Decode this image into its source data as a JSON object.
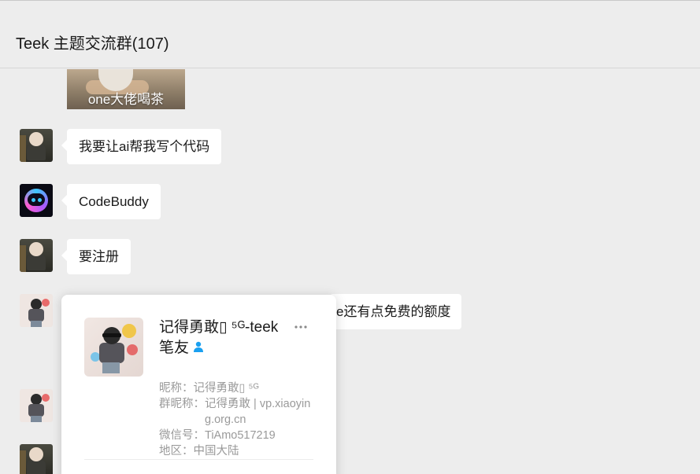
{
  "header": {
    "title": "Teek 主题交流群(107)"
  },
  "messages": [
    {
      "type": "image",
      "caption": "one大佬喝茶"
    },
    {
      "type": "text",
      "text": "我要让ai帮我写个代码"
    },
    {
      "type": "text",
      "text": "CodeBuddy"
    },
    {
      "type": "text",
      "text": "要注册"
    },
    {
      "type": "text",
      "text": "e还有点免费的额度"
    }
  ],
  "profile_card": {
    "name": "记得勇敢\u0000 ⁵ᴳ-teek笔友",
    "name_display": "记得勇敢▯ ⁵ᴳ-teek笔友",
    "nickname_label": "昵称：",
    "nickname_value": "记得勇敢▯ ⁵ᴳ",
    "group_nickname_label": "群昵称：",
    "group_nickname_value": "记得勇敢 | vp.xiaoying.org.cn",
    "wechat_id_label": "微信号：",
    "wechat_id_value": "TiAmo517219",
    "region_label": "地区：",
    "region_value": "中国大陆",
    "more_icon": "more-dots-icon",
    "contact_icon": "person-icon",
    "contact_icon_color": "#1aa0f0"
  }
}
